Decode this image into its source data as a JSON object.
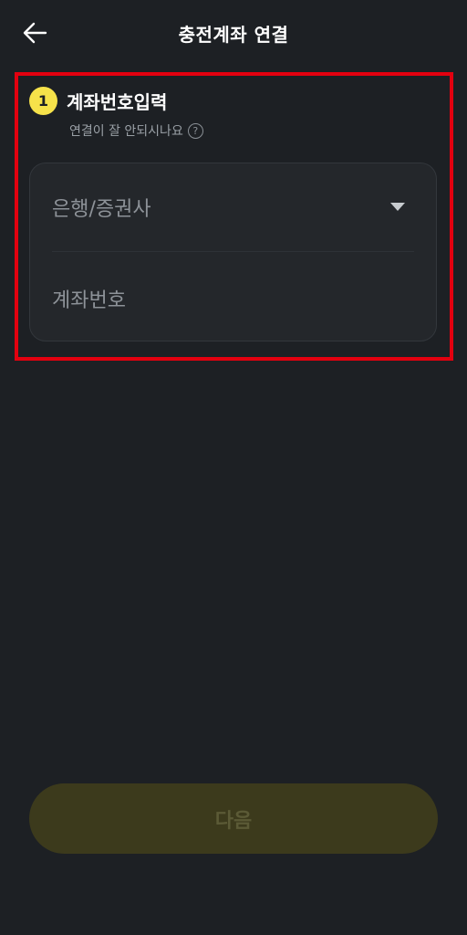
{
  "header": {
    "back_icon": "arrow-left-icon",
    "title": "충전계좌 연결"
  },
  "step": {
    "number": "1",
    "title": "계좌번호입력",
    "help_text": "연결이 잘 안되시나요",
    "help_icon_glyph": "?"
  },
  "form": {
    "bank_placeholder": "은행/증권사",
    "account_placeholder": "계좌번호"
  },
  "footer": {
    "next_label": "다음"
  },
  "colors": {
    "background": "#1d2024",
    "badge": "#f6e24a",
    "highlight": "#e3000f",
    "next_button_disabled": "#3c3a1c"
  }
}
